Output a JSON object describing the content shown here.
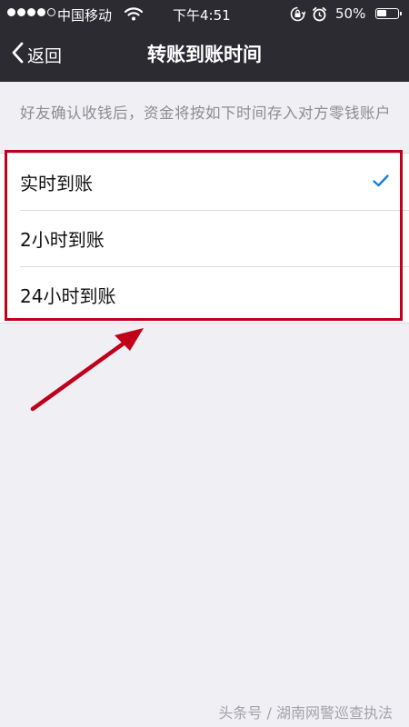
{
  "status_bar": {
    "signal_icon": "signal-dots-icon",
    "carrier": "中国移动",
    "wifi_icon": "wifi-icon",
    "time": "下午4:51",
    "rotation_lock_icon": "rotation-lock-icon",
    "alarm_icon": "alarm-icon",
    "battery_percent": "50%",
    "battery_level": 0.5
  },
  "nav": {
    "back_label": "返回",
    "title": "转账到账时间"
  },
  "description": "好友确认收钱后，资金将按如下时间存入对方零钱账户",
  "options": [
    {
      "label": "实时到账",
      "selected": true
    },
    {
      "label": "2小时到账",
      "selected": false
    },
    {
      "label": "24小时到账",
      "selected": false
    }
  ],
  "watermark": "头条号 / 湖南网警巡查执法",
  "colors": {
    "nav_background": "#2b2b31",
    "page_background": "#efeff4",
    "check_color": "#1a7ee6",
    "annotation_red": "#c0001a"
  }
}
